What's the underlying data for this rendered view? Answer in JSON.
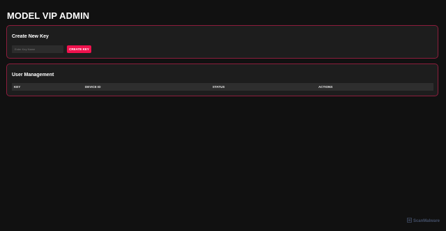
{
  "header": {
    "title": "MODEL VIP ADMIN"
  },
  "create_key": {
    "title": "Create New Key",
    "input_placeholder": "Enter Key Name",
    "input_value": "",
    "button_label": "CREATE KEY"
  },
  "user_management": {
    "title": "User Management",
    "columns": [
      "KEY",
      "DEVICE ID",
      "STATUS",
      "ACTIONS"
    ],
    "rows": []
  },
  "watermark": {
    "text": "ScanMalware",
    "icon": "scanmalware-logo-icon"
  },
  "colors": {
    "background": "#111111",
    "card": "#1d1d1d",
    "card_border": "#8c1d3c",
    "accent": "#f0124e"
  }
}
